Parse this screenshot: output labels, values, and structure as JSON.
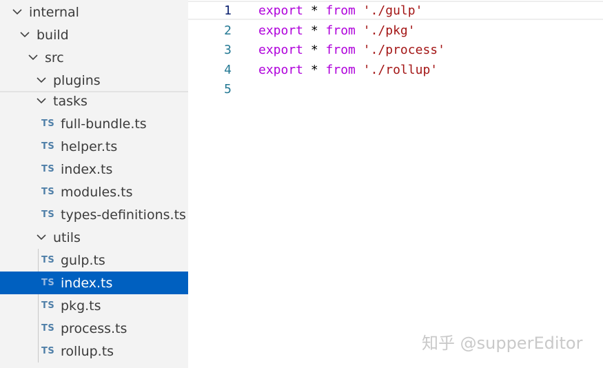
{
  "explorer": {
    "folders": {
      "internal": "internal",
      "build": "build",
      "src": "src",
      "plugins": "plugins",
      "tasks": "tasks",
      "utils": "utils"
    },
    "ts_badge": "TS",
    "tasks_files": [
      "full-bundle.ts",
      "helper.ts",
      "index.ts",
      "modules.ts",
      "types-definitions.ts"
    ],
    "utils_files": [
      "gulp.ts",
      "index.ts",
      "pkg.ts",
      "process.ts",
      "rollup.ts"
    ],
    "selected_file": "index.ts"
  },
  "editor": {
    "current_line": 1,
    "lines": [
      {
        "num": "1",
        "kw": "export",
        "op": " * ",
        "from": "from",
        "str": "'./gulp'"
      },
      {
        "num": "2",
        "kw": "export",
        "op": " * ",
        "from": "from",
        "str": "'./pkg'"
      },
      {
        "num": "3",
        "kw": "export",
        "op": " * ",
        "from": "from",
        "str": "'./process'"
      },
      {
        "num": "4",
        "kw": "export",
        "op": " * ",
        "from": "from",
        "str": "'./rollup'"
      },
      {
        "num": "5",
        "kw": "",
        "op": "",
        "from": "",
        "str": ""
      }
    ]
  },
  "watermark": "知乎 @supperEditor",
  "colors": {
    "selection": "#0060c0",
    "keyword": "#af00db",
    "string": "#a31515",
    "line_number": "#237893",
    "ts_icon": "#4f7fa8"
  }
}
